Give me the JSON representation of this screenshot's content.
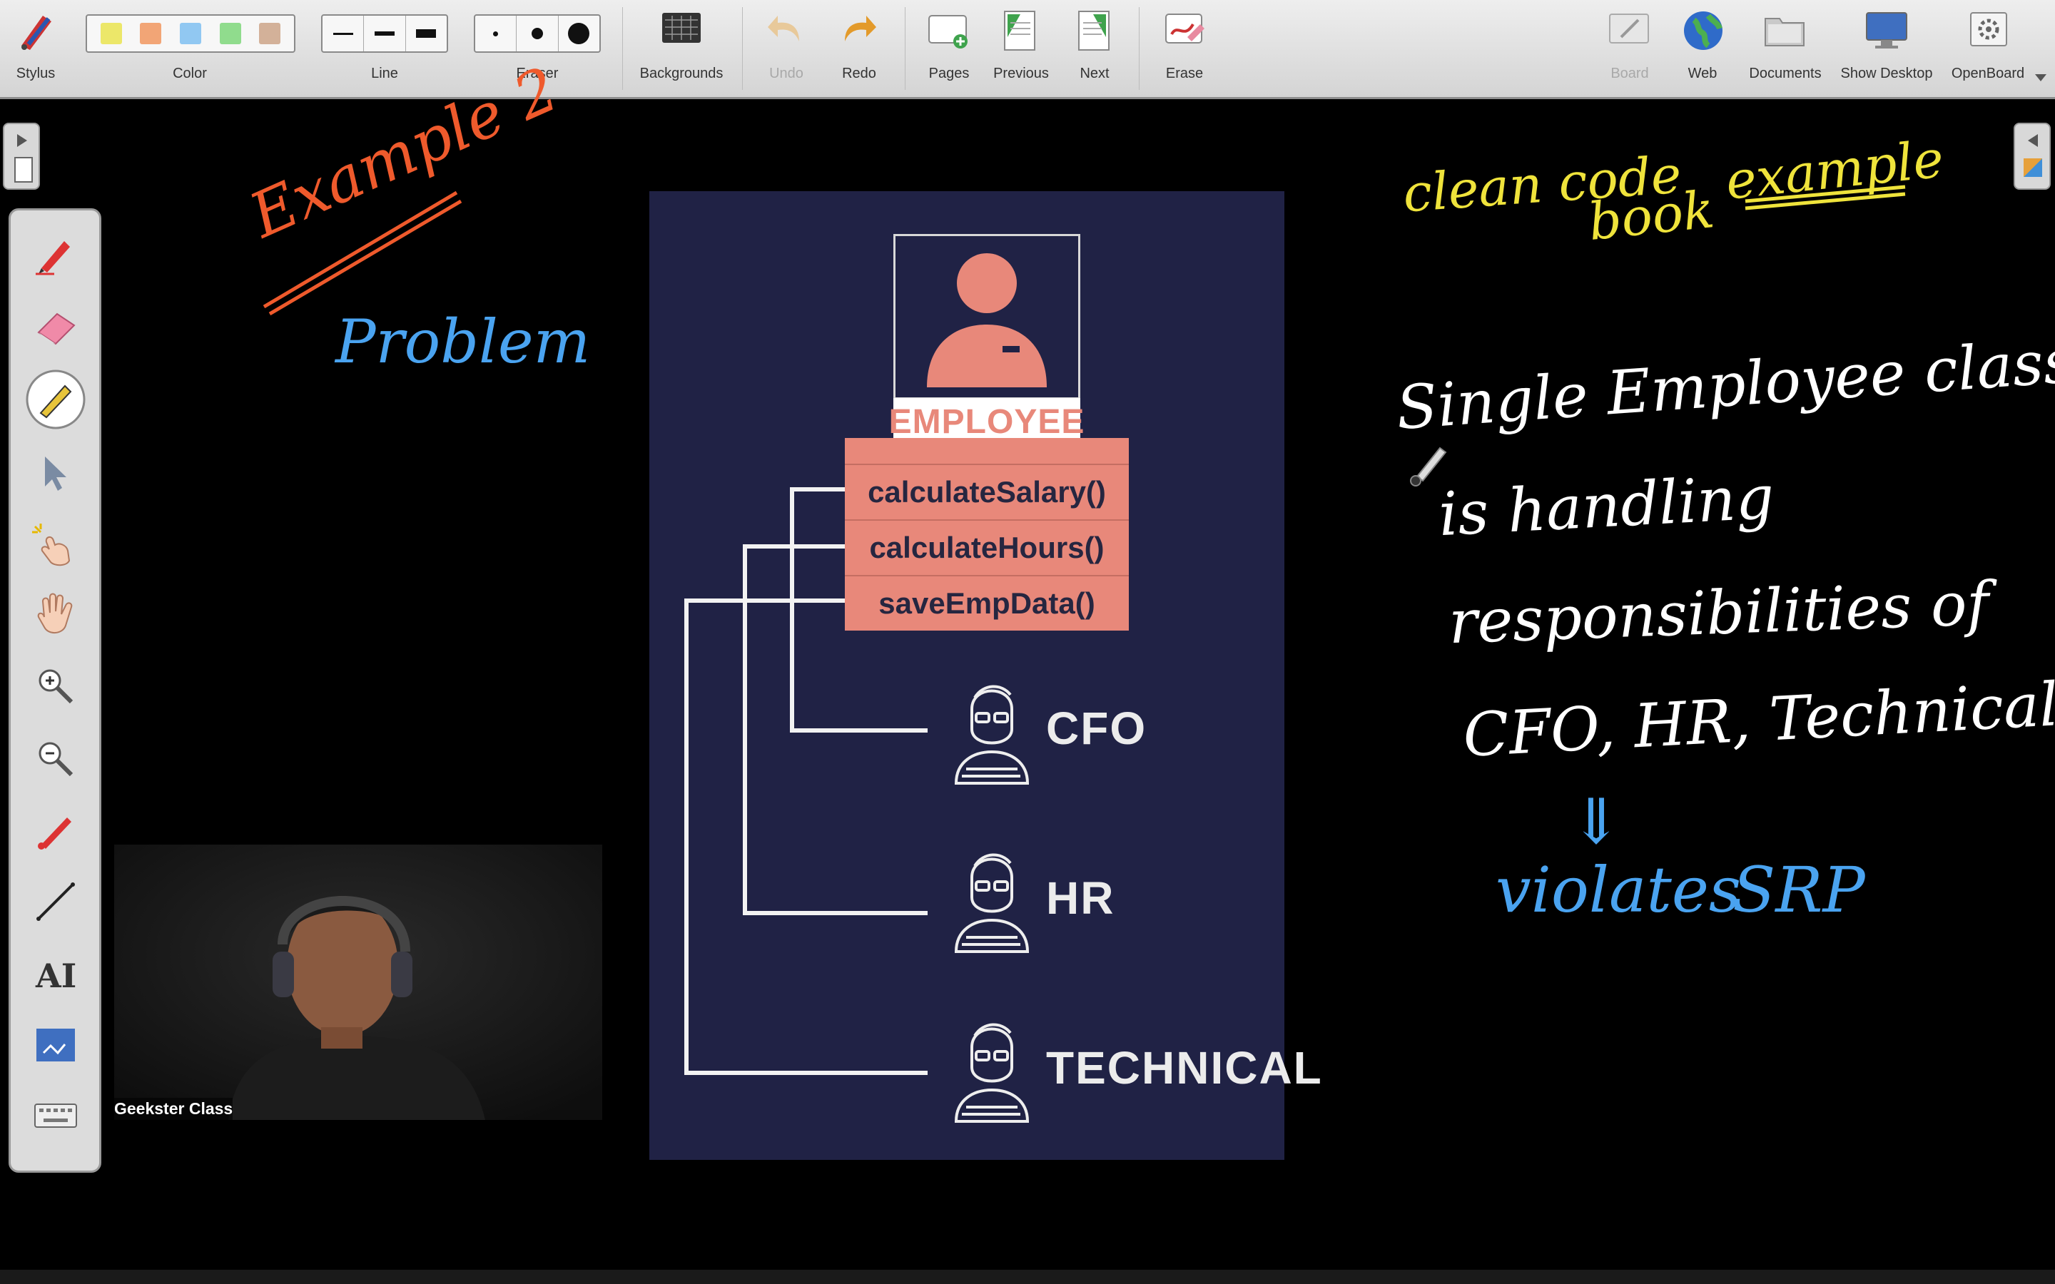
{
  "toolbar": {
    "stylus": "Stylus",
    "color": "Color",
    "line": "Line",
    "eraser": "Eraser",
    "backgrounds": "Backgrounds",
    "undo": "Undo",
    "redo": "Redo",
    "pages": "Pages",
    "previous": "Previous",
    "next": "Next",
    "erase": "Erase",
    "board": "Board",
    "web": "Web",
    "documents": "Documents",
    "show_desktop": "Show Desktop",
    "openboard": "OpenBoard",
    "palette_colors": [
      "#e8e23a",
      "#f08a4b",
      "#6fb8f0",
      "#6ed36a",
      "#c79a7a"
    ]
  },
  "side_tools": [
    "pen-icon",
    "eraser-icon",
    "marker-icon",
    "selector-icon",
    "interactor-icon",
    "hand-icon",
    "zoom-in-icon",
    "zoom-out-icon",
    "laser-pointer-icon",
    "line-icon",
    "text-icon",
    "capture-icon",
    "keyboard-icon"
  ],
  "slide": {
    "title": "EMPLOYEE",
    "methods": [
      "calculateSalary()",
      "calculateHours()",
      "saveEmpData()"
    ],
    "roles": [
      "CFO",
      "HR",
      "TECHNICAL"
    ],
    "accent": "#e8887a",
    "background": "#202245"
  },
  "video": {
    "name": "Geekster Class"
  },
  "annotations": {
    "example": "Example 2",
    "problem": "Problem",
    "clean_code": "clean code",
    "book": "book",
    "example_right": "example",
    "line1": "Single Employee class",
    "line2": "is handling",
    "line3": "responsibilities of",
    "line4": "CFO, HR, Technical",
    "arrow": "⇓",
    "violates": "violates",
    "srp": "SRP"
  }
}
